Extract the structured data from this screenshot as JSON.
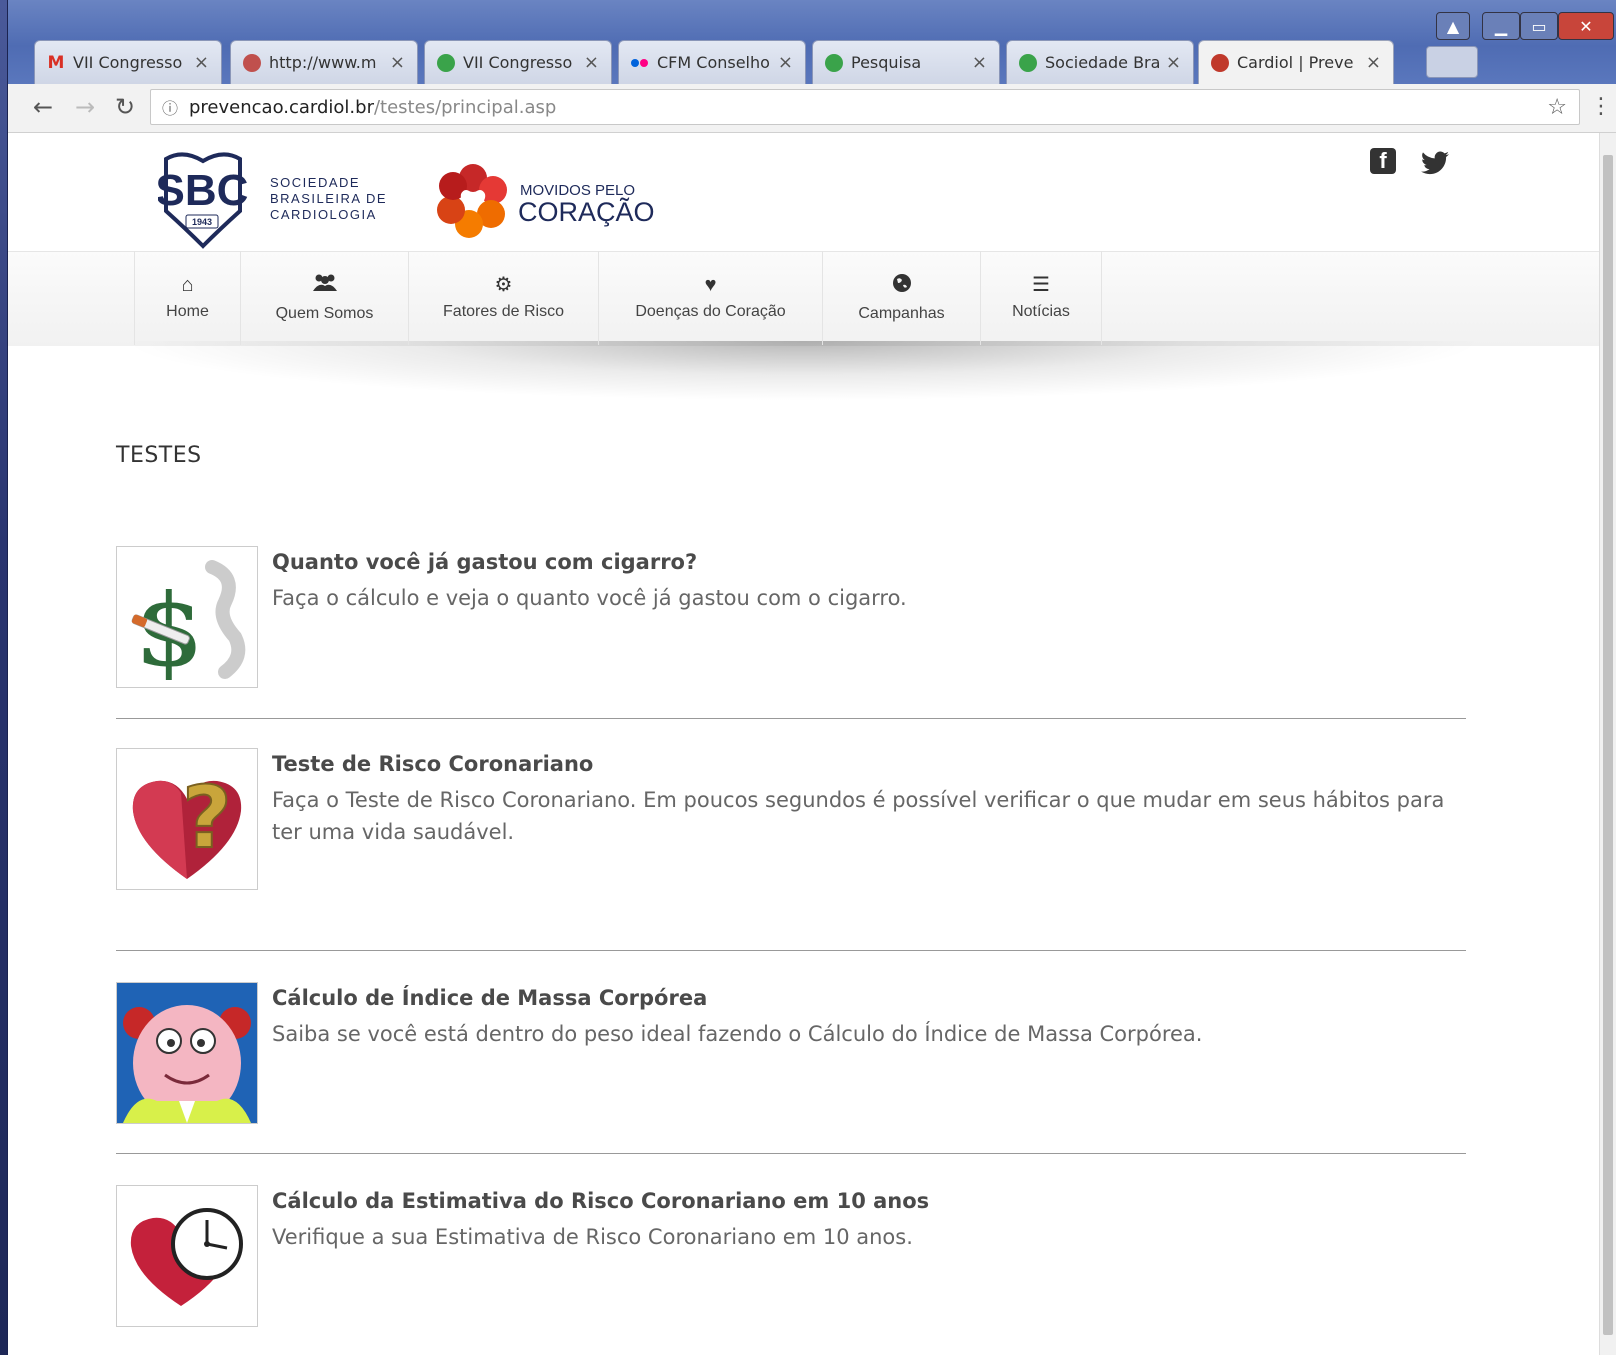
{
  "browser": {
    "tabs": [
      {
        "label": "VII Congresso",
        "favicon": "gmail-icon",
        "color": "#d93025"
      },
      {
        "label": "http://www.m",
        "favicon": "avatar-icon",
        "color": "#c0504d"
      },
      {
        "label": "VII Congresso",
        "favicon": "green-shield-icon",
        "color": "#3aa34a"
      },
      {
        "label": "CFM Conselho",
        "favicon": "flickr-icon",
        "color": "#0063dc"
      },
      {
        "label": "Pesquisa",
        "favicon": "green-shield-icon",
        "color": "#3aa34a"
      },
      {
        "label": "Sociedade Bra",
        "favicon": "green-shield-icon",
        "color": "#3aa34a"
      },
      {
        "label": "Cardiol | Preve",
        "favicon": "heart-flower-icon",
        "color": "#c0392b"
      }
    ],
    "url_host": "prevencao.cardiol.br",
    "url_path": "/testes/principal.asp"
  },
  "header": {
    "sbc_line1": "SOCIEDADE",
    "sbc_line2": "BRASILEIRA DE",
    "sbc_line3": "CARDIOLOGIA",
    "sbc_abbr": "SBC",
    "sbc_year": "1943",
    "mov_line1": "MOVIDOS PELO",
    "mov_line2": "CORAÇÃO"
  },
  "nav": {
    "items": [
      {
        "label": "Home",
        "icon": "home-icon"
      },
      {
        "label": "Quem Somos",
        "icon": "users-icon"
      },
      {
        "label": "Fatores de Risco",
        "icon": "gears-icon"
      },
      {
        "label": "Doenças do Coração",
        "icon": "heart-icon"
      },
      {
        "label": "Campanhas",
        "icon": "globe-icon"
      },
      {
        "label": "Notícias",
        "icon": "list-icon"
      }
    ]
  },
  "main": {
    "section_title": "TESTES",
    "tests": [
      {
        "title": "Quanto você já gastou com cigarro?",
        "desc": "Faça o cálculo e veja o quanto você já gastou com o cigarro."
      },
      {
        "title": "Teste de Risco Coronariano",
        "desc": "Faça o Teste de Risco Coronariano. Em poucos segundos é possível verificar o que mudar em seus hábitos para ter uma vida saudável."
      },
      {
        "title": "Cálculo de Índice de Massa Corpórea",
        "desc": "Saiba se você está dentro do peso ideal fazendo o Cálculo do Índice de Massa Corpórea."
      },
      {
        "title": "Cálculo da Estimativa do Risco Coronariano em 10 anos",
        "desc": "Verifique a sua Estimativa de Risco Coronariano em 10 anos."
      }
    ]
  },
  "colors": {
    "sbc_blue": "#1e2a5a",
    "text_dark": "#4a4a4a",
    "text_muted": "#666666"
  }
}
